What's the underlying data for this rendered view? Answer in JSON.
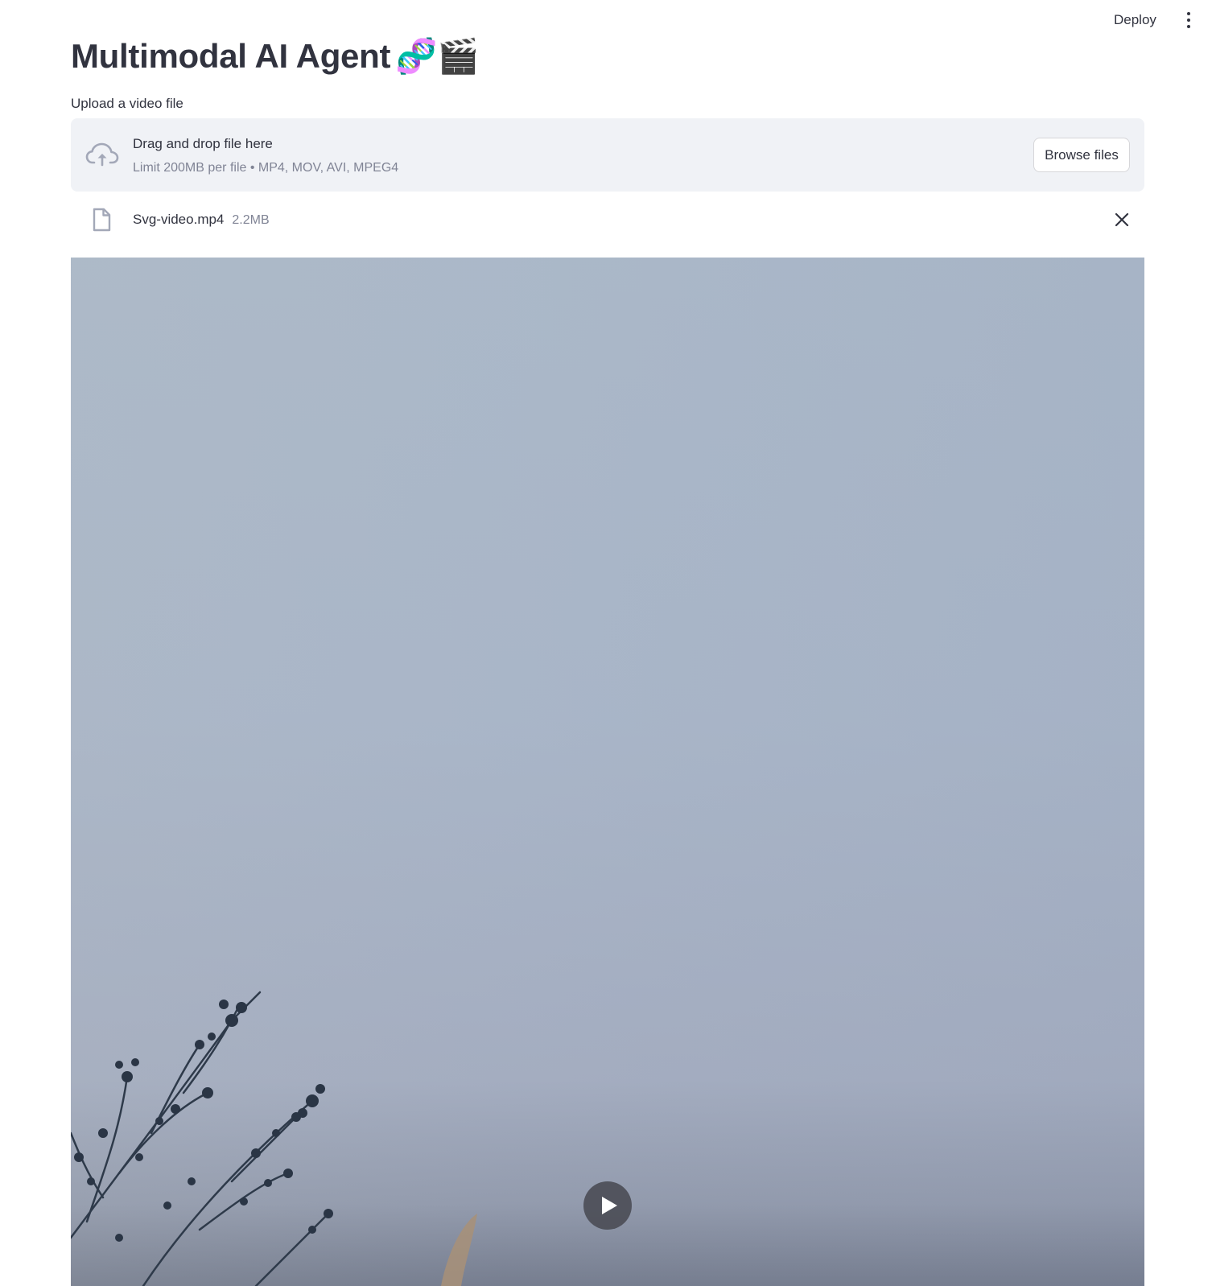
{
  "header": {
    "deploy_label": "Deploy",
    "menu_icon": "kebab-menu-icon"
  },
  "main": {
    "title": "Multimodal AI Agent",
    "title_emoji": "🧬🎬",
    "uploader": {
      "label": "Upload a video file",
      "dropzone_title": "Drag and drop file here",
      "dropzone_limit": "Limit 200MB per file • MP4, MOV, AVI, MPEG4",
      "browse_label": "Browse files",
      "upload_icon": "cloud-upload-icon"
    },
    "uploaded_file": {
      "name": "Svg-video.mp4",
      "size": "2.2MB",
      "file_icon": "file-icon",
      "remove_icon": "close-icon"
    },
    "video": {
      "play_icon": "play-icon"
    }
  },
  "colors": {
    "text": "#31333f",
    "muted": "#808495",
    "dropzone_bg": "#f0f2f6",
    "icon_gray": "#a3a8b8"
  }
}
